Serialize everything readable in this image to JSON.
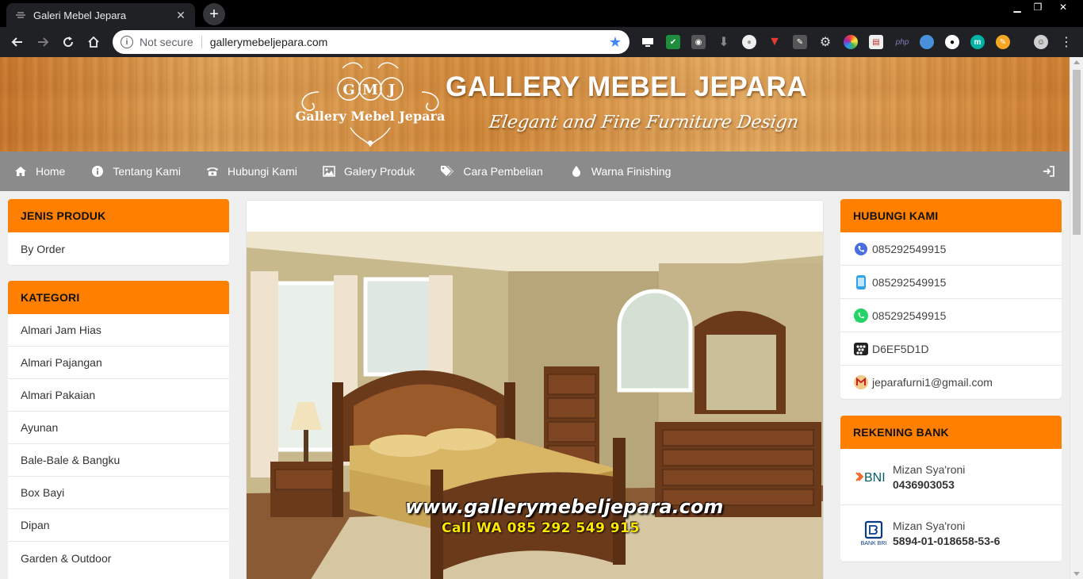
{
  "browser": {
    "tab_title": "Galeri Mebel Jepara",
    "security_label": "Not secure",
    "url": "gallerymebeljepara.com",
    "extensions": [
      "monitor",
      "check-shield",
      "location",
      "download",
      "circle-white",
      "vivaldi-shield",
      "pdf",
      "gear",
      "color-wheel",
      "calendar",
      "php",
      "earth",
      "circle-dark",
      "m-teal",
      "chromeapp",
      "avatar"
    ]
  },
  "header": {
    "logo_monogram": "GMJ",
    "logo_text": "Gallery Mebel Jepara",
    "title": "GALLERY MEBEL JEPARA",
    "tagline": "Elegant and Fine Furniture Design"
  },
  "nav": {
    "items": [
      {
        "label": "Home",
        "icon": "home-icon"
      },
      {
        "label": "Tentang Kami",
        "icon": "info-icon"
      },
      {
        "label": "Hubungi Kami",
        "icon": "phone-icon"
      },
      {
        "label": "Galery Produk",
        "icon": "image-icon"
      },
      {
        "label": "Cara Pembelian",
        "icon": "tags-icon"
      },
      {
        "label": "Warna Finishing",
        "icon": "drop-icon"
      }
    ]
  },
  "sidebar_left": {
    "jenis_produk": {
      "title": "JENIS PRODUK",
      "items": [
        "By Order"
      ]
    },
    "kategori": {
      "title": "KATEGORI",
      "items": [
        "Almari Jam Hias",
        "Almari Pajangan",
        "Almari Pakaian",
        "Ayunan",
        "Bale-Bale & Bangku",
        "Box Bayi",
        "Dipan",
        "Garden & Outdoor"
      ]
    }
  },
  "main": {
    "watermark_site": "www.gallerymebeljepara.com",
    "watermark_call": "Call  WA 085  292  549  915"
  },
  "sidebar_right": {
    "hubungi": {
      "title": "HUBUNGI KAMI",
      "phone": "085292549915",
      "mobile": "085292549915",
      "whatsapp": "085292549915",
      "bbm": "D6EF5D1D",
      "email": "jeparafurni1@gmail.com"
    },
    "rekening": {
      "title": "REKENING BANK",
      "accounts": [
        {
          "bank": "BNI",
          "name": "Mizan Sya'roni",
          "number": "0436903053"
        },
        {
          "bank": "BANK BRI",
          "name": "Mizan Sya'roni",
          "number": "5894-01-018658-53-6"
        }
      ]
    }
  },
  "colors": {
    "accent": "#ff7f00",
    "nav_bg": "#8b8b8b",
    "page_bg": "#efefef"
  }
}
